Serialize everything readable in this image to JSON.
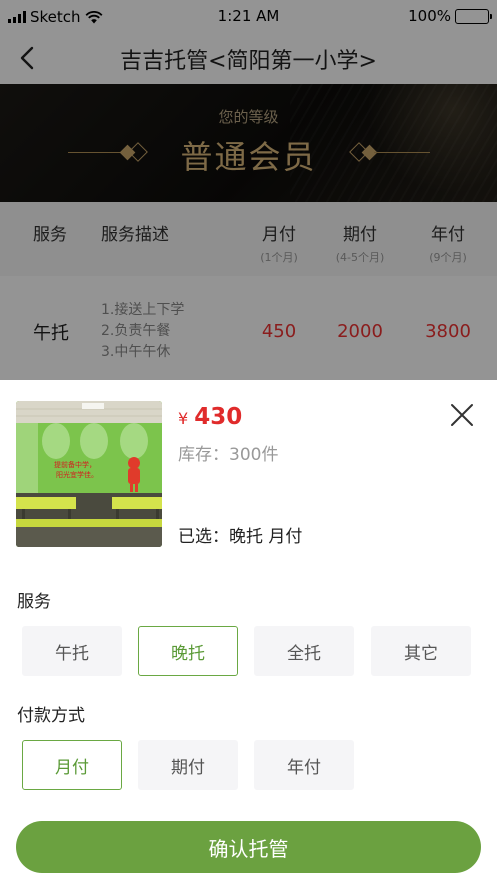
{
  "status_bar": {
    "carrier": "Sketch",
    "time": "1:21 AM",
    "battery": "100%",
    "battery_level": 1.0
  },
  "nav": {
    "title": "吉吉托管<简阳第一小学>"
  },
  "banner": {
    "subtitle": "您的等级",
    "level": "普通会员"
  },
  "table": {
    "headers": [
      {
        "label": "服务",
        "sub": ""
      },
      {
        "label": "服务描述",
        "sub": ""
      },
      {
        "label": "月付",
        "sub": "(1个月)"
      },
      {
        "label": "期付",
        "sub": "(4-5个月)"
      },
      {
        "label": "年付",
        "sub": "(9个月)"
      }
    ],
    "row": {
      "service": "午托",
      "desc": [
        "1.接送上下学",
        "2.负责午餐",
        "3.中午午休"
      ],
      "prices": [
        "450",
        "2000",
        "3800"
      ]
    }
  },
  "sheet": {
    "currency": "¥",
    "price": "430",
    "stock": "库存：300件",
    "selected": "已选：晚托  月付",
    "service_label": "服务",
    "service_options": [
      "午托",
      "晚托",
      "全托",
      "其它"
    ],
    "service_selected_index": 1,
    "payment_label": "付款方式",
    "payment_options": [
      "月付",
      "期付",
      "年付"
    ],
    "payment_selected_index": 0,
    "confirm_label": "确认托管",
    "thumbnail_sign": [
      "提前备中学，",
      "阳光宜学佳。"
    ]
  },
  "colors": {
    "accent_green": "#6ba140",
    "price_red": "#e02b2b",
    "gold": "#d9b77a"
  }
}
